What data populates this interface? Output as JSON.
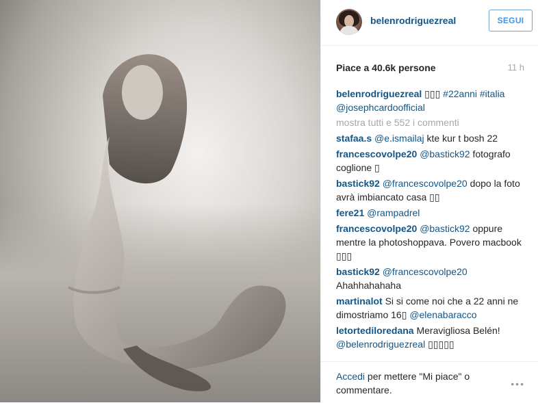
{
  "post": {
    "username": "belenrodriguezreal",
    "follow_label": "SEGUI",
    "likes": "Piace a 40.6k persone",
    "time": "11 h"
  },
  "caption": {
    "user": "belenrodriguezreal",
    "emoji": "▯▯▯",
    "hashtag": "#22anni",
    "hashtag2": "#italia",
    "mention": "@josephcardoofficial"
  },
  "show_all_comments": "mostra tutti e 552 i commenti",
  "comments": [
    {
      "user": "stafaa.s",
      "mention": "@e.ismailaj",
      "text": "kte kur t bosh 22"
    },
    {
      "user": "francescovolpe20",
      "mention": "@bastick92",
      "text": "fotografo coglione ▯"
    },
    {
      "user": "bastick92",
      "mention": "@francescovolpe20",
      "text": "dopo la foto avrà imbiancato casa ▯▯"
    },
    {
      "user": "fere21",
      "mention": "@rampadrel",
      "text": ""
    },
    {
      "user": "francescovolpe20",
      "mention": "@bastick92",
      "text": "oppure mentre la photoshoppava. Povero macbook ▯▯▯"
    },
    {
      "user": "bastick92",
      "mention": "@francescovolpe20",
      "text": "Ahahhahahaha"
    },
    {
      "user": "martinalot",
      "mention": "",
      "text": "Si si come noi che a 22 anni ne dimostriamo 16▯",
      "mention_after": "@elenabaracco"
    },
    {
      "user": "letortediloredana",
      "mention": "",
      "text": "Meravigliosa Belén!",
      "mention_after": "@belenrodriguezreal",
      "emoji_after": "▯▯▯▯▯"
    }
  ],
  "footer": {
    "login_link": "Accedi",
    "login_text": "per mettere \"Mi piace\" o commentare.",
    "more_icon": "•••"
  },
  "icons": {
    "more": "more-options-icon"
  }
}
